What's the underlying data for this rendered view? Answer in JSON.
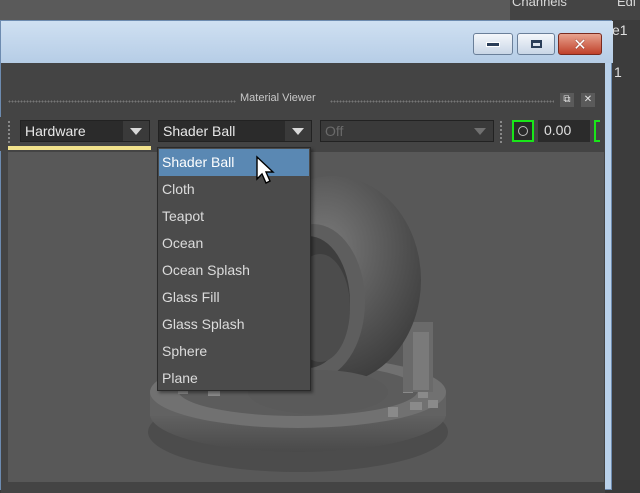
{
  "background": {
    "channels_label": "Channels",
    "edit_label": "Edi",
    "side_text_1": "e1",
    "side_text_2": "1"
  },
  "window": {
    "controls": {
      "minimize": "minimize",
      "maximize": "maximize",
      "close": "close"
    }
  },
  "panel": {
    "title": "Material Viewer"
  },
  "toolbar": {
    "renderer": "Hardware",
    "geometry": "Shader Ball",
    "environment": "Off",
    "value": "0.00"
  },
  "geometry_menu": {
    "selected": "Shader Ball",
    "items": [
      "Shader Ball",
      "Cloth",
      "Teapot",
      "Ocean",
      "Ocean Splash",
      "Glass Fill",
      "Glass Splash",
      "Sphere",
      "Plane"
    ]
  },
  "colors": {
    "selection": "#5a88b3",
    "highlight_green": "#19e619",
    "active_underline": "#f2e28c"
  }
}
